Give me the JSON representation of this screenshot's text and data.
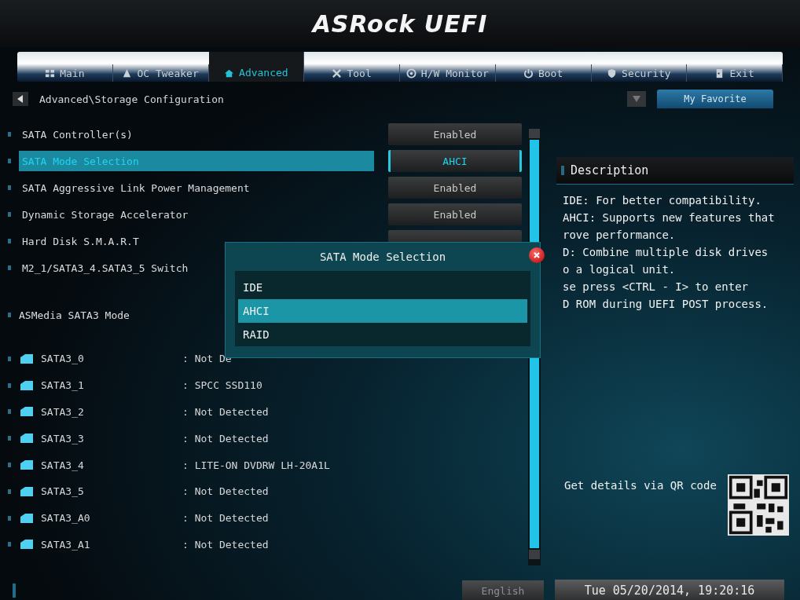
{
  "header": {
    "logo": "ASRock UEFI"
  },
  "tabs": [
    {
      "label": "Main",
      "selected": false
    },
    {
      "label": "OC Tweaker",
      "selected": false
    },
    {
      "label": "Advanced",
      "selected": true
    },
    {
      "label": "Tool",
      "selected": false
    },
    {
      "label": "H/W Monitor",
      "selected": false
    },
    {
      "label": "Boot",
      "selected": false
    },
    {
      "label": "Security",
      "selected": false
    },
    {
      "label": "Exit",
      "selected": false
    }
  ],
  "breadcrumb": "Advanced\\Storage Configuration",
  "favorite_button": "My Favorite",
  "settings": [
    {
      "label": "SATA Controller(s)",
      "value": "Enabled",
      "selected": false
    },
    {
      "label": "SATA Mode Selection",
      "value": "AHCI",
      "selected": true
    },
    {
      "label": "SATA Aggressive Link Power Management",
      "value": "Enabled",
      "selected": false
    },
    {
      "label": "Dynamic Storage Accelerator",
      "value": "Enabled",
      "selected": false
    },
    {
      "label": "Hard Disk S.M.A.R.T",
      "selected": false
    },
    {
      "label": "M2_1/SATA3_4.SATA3_5 Switch",
      "selected": false
    }
  ],
  "section_label": "ASMedia SATA3 Mode",
  "devices": [
    {
      "name": "SATA3_0",
      "value": ": Not De"
    },
    {
      "name": "SATA3_1",
      "value": ": SPCC SSD110"
    },
    {
      "name": "SATA3_2",
      "value": ": Not Detected"
    },
    {
      "name": "SATA3_3",
      "value": ": Not Detected"
    },
    {
      "name": "SATA3_4",
      "value": ": LITE-ON DVDRW LH-20A1L"
    },
    {
      "name": "SATA3_5",
      "value": ": Not Detected"
    },
    {
      "name": "SATA3_A0",
      "value": ": Not Detected"
    },
    {
      "name": "SATA3_A1",
      "value": ": Not Detected"
    }
  ],
  "description": {
    "title": "Description",
    "lines": [
      "IDE: For better compatibility.",
      "AHCI: Supports new features that",
      "rove performance.",
      "D: Combine multiple disk drives",
      "o a logical unit.",
      "se press <CTRL - I> to enter",
      "D ROM during UEFI POST process."
    ]
  },
  "qr_caption": "Get details via QR code",
  "popup": {
    "title": "SATA Mode Selection",
    "options": [
      {
        "label": "IDE",
        "selected": false
      },
      {
        "label": "AHCI",
        "selected": true
      },
      {
        "label": "RAID",
        "selected": false
      }
    ]
  },
  "footer": {
    "language": "English",
    "datetime": "Tue 05/20/2014, 19:20:16"
  }
}
